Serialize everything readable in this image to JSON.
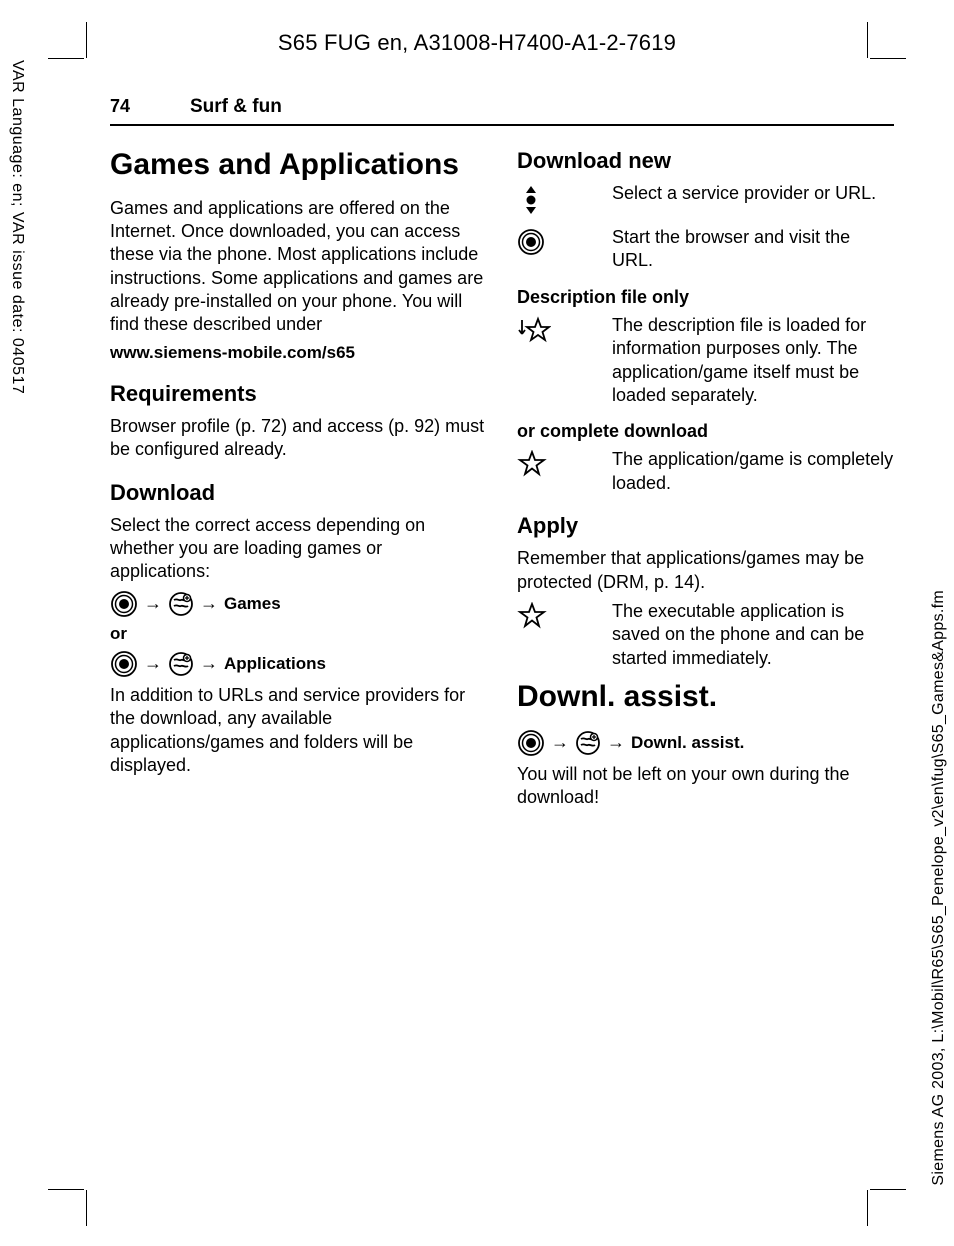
{
  "doc_header": "S65 FUG en, A31008-H7400-A1-2-7619",
  "left_margin": "VAR Language: en; VAR issue date: 040517",
  "right_margin": "Siemens AG 2003, L:\\Mobil\\R65\\S65_Penelope_v2\\en\\fug\\S65_Games&Apps.fm",
  "page_number": "74",
  "section_name": "Surf & fun",
  "left_col": {
    "h1": "Games and Applications",
    "intro": "Games and applications are offered on the Internet. Once downloaded, you can access these via the phone. Most applications include instructions. Some applications and games are already pre-installed on your phone. You will find these described under",
    "url": "www.siemens-mobile.com/s65",
    "h2_req": "Requirements",
    "req_text": "Browser profile (p. 72) and access (p. 92) must be configured already.",
    "h2_dl": "Download",
    "dl_text": "Select the correct access depending on whether you are loading games or applications:",
    "path_games": "Games",
    "or": "or",
    "path_apps": "Applications",
    "dl_footer": "In addition to URLs and service providers for the download, any available applications/games and folders will be displayed."
  },
  "right_col": {
    "h2_dlnew": "Download new",
    "step1": "Select a service provider or URL.",
    "step2": "Start the browser and visit the URL.",
    "h3_desc": "Description file only",
    "desc_text": "The description file is loaded for information purposes only. The application/game itself must be loaded separately.",
    "h3_complete": "or complete download",
    "complete_text": "The application/game is completely loaded.",
    "h2_apply": "Apply",
    "apply_intro": "Remember that applications/games may be protected (DRM, p. 14).",
    "apply_text": "The executable application is saved on the phone and can be started immediately.",
    "h1_assist": "Downl. assist.",
    "path_assist": "Downl. assist.",
    "assist_text": "You will not be left on your own during the download!"
  }
}
